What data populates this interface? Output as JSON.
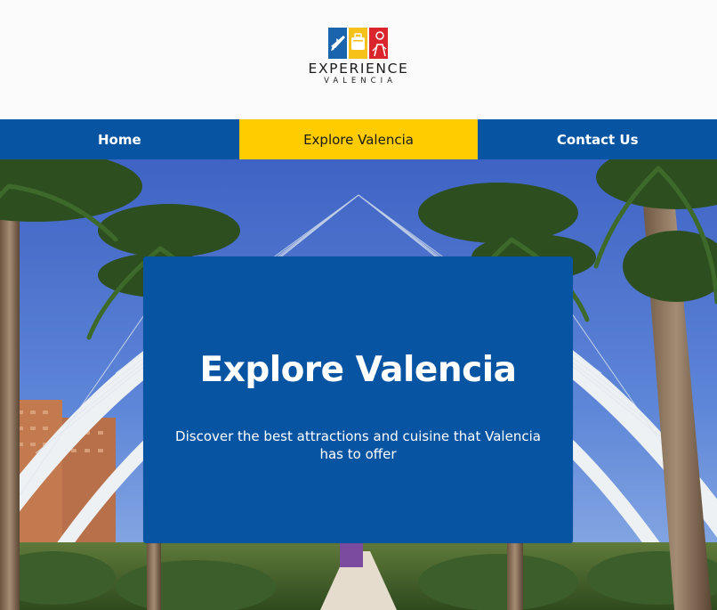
{
  "logo": {
    "title": "EXPERIENCE",
    "subtitle": "VALENCIA",
    "colors": [
      "#1a64ad",
      "#f6c21a",
      "#d9252b"
    ]
  },
  "nav": {
    "items": [
      {
        "label": "Home",
        "active": false
      },
      {
        "label": "Explore Valencia",
        "active": true
      },
      {
        "label": "Contact Us",
        "active": false
      }
    ]
  },
  "hero": {
    "title": "Explore Valencia",
    "subtitle": "Discover the best attractions and cuisine that Valencia has to offer"
  },
  "colors": {
    "primary_blue": "#0755a2",
    "accent_yellow": "#ffcc00",
    "header_bg": "#fbfbfb"
  }
}
